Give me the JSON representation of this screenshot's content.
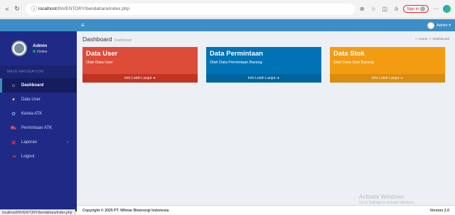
{
  "browser": {
    "url_host": "localhost",
    "url_path": "/INVENTORY/bendahara/index.php",
    "signin_label": "Sign in",
    "icons": [
      "back-icon",
      "refresh-icon",
      "info-icon",
      "zoom-icon",
      "star-icon",
      "extensions-icon",
      "favorites-icon",
      "more-icon"
    ]
  },
  "sidebar": {
    "user_name": "Admin",
    "user_status": "Online",
    "nav_header": "MAIN NAVIGATION",
    "items": [
      {
        "label": "Dashboard",
        "icon": "⌂"
      },
      {
        "label": "Data User",
        "icon": "♥"
      },
      {
        "label": "Kelola ATK",
        "icon": "✿"
      },
      {
        "label": "Permintaan ATK",
        "icon": "⛟"
      },
      {
        "label": "Laporan",
        "icon": "▣"
      },
      {
        "label": "Logout",
        "icon": "⇥"
      }
    ]
  },
  "topbar": {
    "menu_icon": "≡",
    "admin_label": "Admin ▾"
  },
  "header": {
    "title": "Dashboard",
    "subtitle": "Dashboard",
    "breadcrumb_home": "Home",
    "breadcrumb_sep": ">",
    "breadcrumb_current": "Dashboard"
  },
  "boxes": [
    {
      "title": "Data User",
      "sub": "Olah Data User",
      "footer": "Info Lebih Lanjut ➜",
      "color": "#dd4b39"
    },
    {
      "title": "Data Permintaan",
      "sub": "Olah Data Permintaan Barang",
      "footer": "Info Lebih Lanjut ➜",
      "color": "#0073b7"
    },
    {
      "title": "Data Stok",
      "sub": "Olah Data Stok Barang",
      "footer": "Info Lebih Lanjut ➜",
      "color": "#f39c12"
    }
  ],
  "watermark": {
    "line1": "Activate Windows",
    "line2": "Go to Settings to activate Windows."
  },
  "footer": {
    "copyright": "Copyright © 2025 PT. Wilmar Bioenergi Indonesia",
    "version": "Version 2.0"
  },
  "status_url": "localhost/INVENTORY/bendahara/index.php"
}
